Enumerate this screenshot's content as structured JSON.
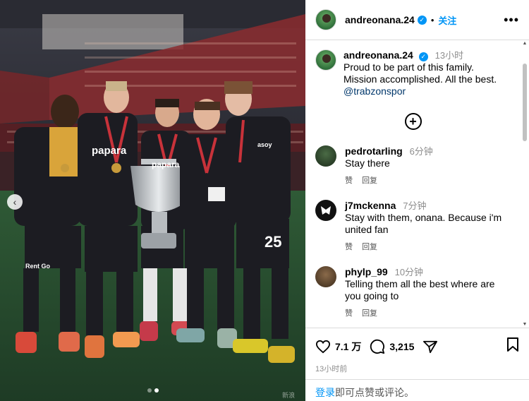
{
  "header": {
    "username": "andreonana.24",
    "follow_label": "关注",
    "more_label": "•••"
  },
  "caption": {
    "username": "andreonana.24",
    "time": "13小时",
    "line1": "Proud to be part of this family.",
    "line2": "Mission accomplished. All the best.",
    "mention": "@trabzonspor"
  },
  "comments": [
    {
      "username": "pedrotarling",
      "time": "6分钟",
      "text": "Stay there",
      "like": "赞",
      "reply": "回复"
    },
    {
      "username": "j7mckenna",
      "time": "7分钟",
      "text": "Stay with them, onana. Because i'm united fan",
      "like": "赞",
      "reply": "回复"
    },
    {
      "username": "phylp_99",
      "time": "10分钟",
      "text": "Telling them all the best where are you going to",
      "like": "赞",
      "reply": "回复"
    }
  ],
  "footer": {
    "likes": "7.1 万",
    "comments": "3,215",
    "post_time": "13小时前",
    "login_link": "登录",
    "login_text": "即可点赞或评论。"
  },
  "photo": {
    "sponsor": "papara",
    "sponsor2": "Rent Go",
    "jersey_number": "25",
    "badge": "asoy",
    "watermark": "新浪"
  },
  "colors": {
    "accent": "#0095f6",
    "kit": "#1c1c22",
    "medal_ribbon": "#c8323a",
    "grass": "#2f5a36"
  }
}
